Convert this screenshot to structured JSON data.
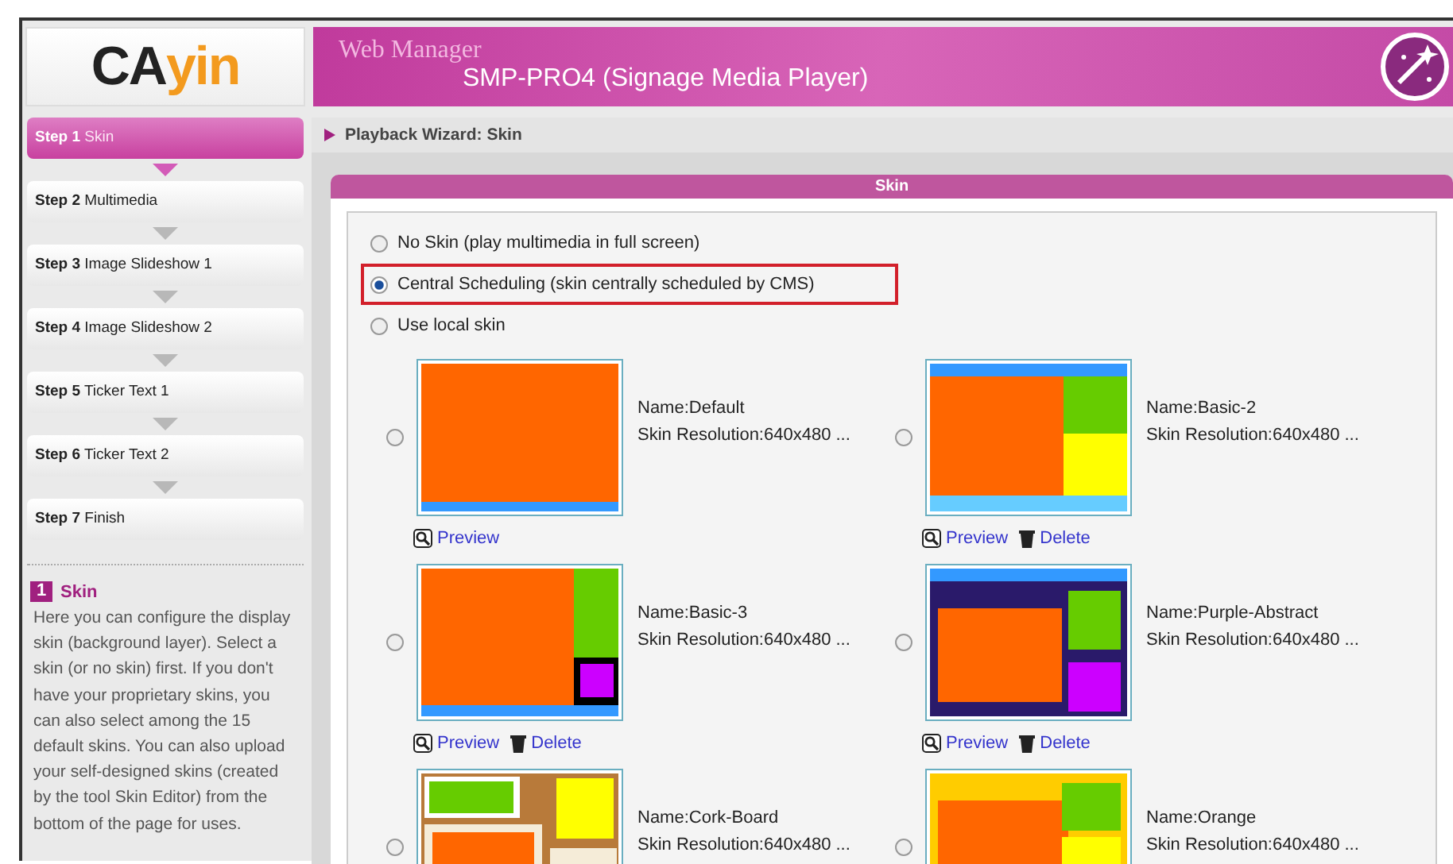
{
  "logo": {
    "parts": [
      "CA",
      "yin"
    ]
  },
  "header": {
    "app_name": "Web Manager",
    "device": "SMP-PRO4 (Signage Media Player)"
  },
  "steps": [
    {
      "number": "Step 1",
      "label": "Skin",
      "selected": true
    },
    {
      "number": "Step 2",
      "label": "Multimedia",
      "selected": false
    },
    {
      "number": "Step 3",
      "label": "Image Slideshow 1",
      "selected": false
    },
    {
      "number": "Step 4",
      "label": "Image Slideshow 2",
      "selected": false
    },
    {
      "number": "Step 5",
      "label": "Ticker Text 1",
      "selected": false
    },
    {
      "number": "Step 6",
      "label": "Ticker Text 2",
      "selected": false
    },
    {
      "number": "Step 7",
      "label": "Finish",
      "selected": false
    }
  ],
  "help": {
    "badge": "1",
    "title": "Skin",
    "text": "Here you can configure the display skin (background layer). Select a skin (or no skin) first. If you don't have your proprietary skins, you can also select among the 15 default skins. You can also upload your self-designed skins (created by the tool Skin Editor) from the bottom of the page for uses."
  },
  "breadcrumb": "Playback Wizard: Skin",
  "panel_title": "Skin",
  "options": [
    {
      "label": "No Skin (play multimedia in full screen)",
      "selected": false,
      "highlighted": false
    },
    {
      "label": "Central Scheduling (skin centrally scheduled by CMS)",
      "selected": true,
      "highlighted": true
    },
    {
      "label": "Use local skin",
      "selected": false,
      "highlighted": false
    }
  ],
  "skins": [
    {
      "kind": "default",
      "name": "Name:Default",
      "resolution": "Skin Resolution:640x480 ...",
      "selected": false,
      "preview": "Preview"
    },
    {
      "kind": "basic2",
      "name": "Name:Basic-2",
      "resolution": "Skin Resolution:640x480 ...",
      "selected": false,
      "preview": "Preview",
      "delete": "Delete"
    },
    {
      "kind": "basic3",
      "name": "Name:Basic-3",
      "resolution": "Skin Resolution:640x480 ...",
      "selected": false,
      "preview": "Preview",
      "delete": "Delete"
    },
    {
      "kind": "purple",
      "name": "Name:Purple-Abstract",
      "resolution": "Skin Resolution:640x480 ...",
      "selected": false,
      "preview": "Preview",
      "delete": "Delete"
    },
    {
      "kind": "cork",
      "name": "Name:Cork-Board",
      "resolution": "Skin Resolution:640x480 ...",
      "selected": false
    },
    {
      "kind": "orange",
      "name": "Name:Orange",
      "resolution": "Skin Resolution:640x480 ...",
      "selected": false
    }
  ]
}
